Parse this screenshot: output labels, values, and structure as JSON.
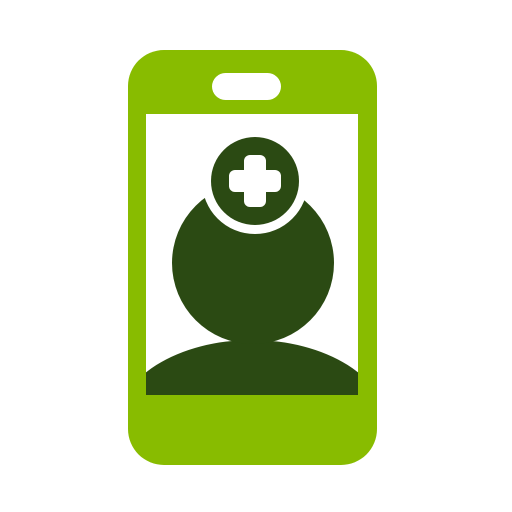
{
  "icon": {
    "name": "telemedicine-phone-icon",
    "colors": {
      "phone_body": "#88bc00",
      "screen": "#ffffff",
      "figure": "#2b4a13",
      "plus_sign": "#ffffff",
      "background": "#ffffff"
    }
  }
}
